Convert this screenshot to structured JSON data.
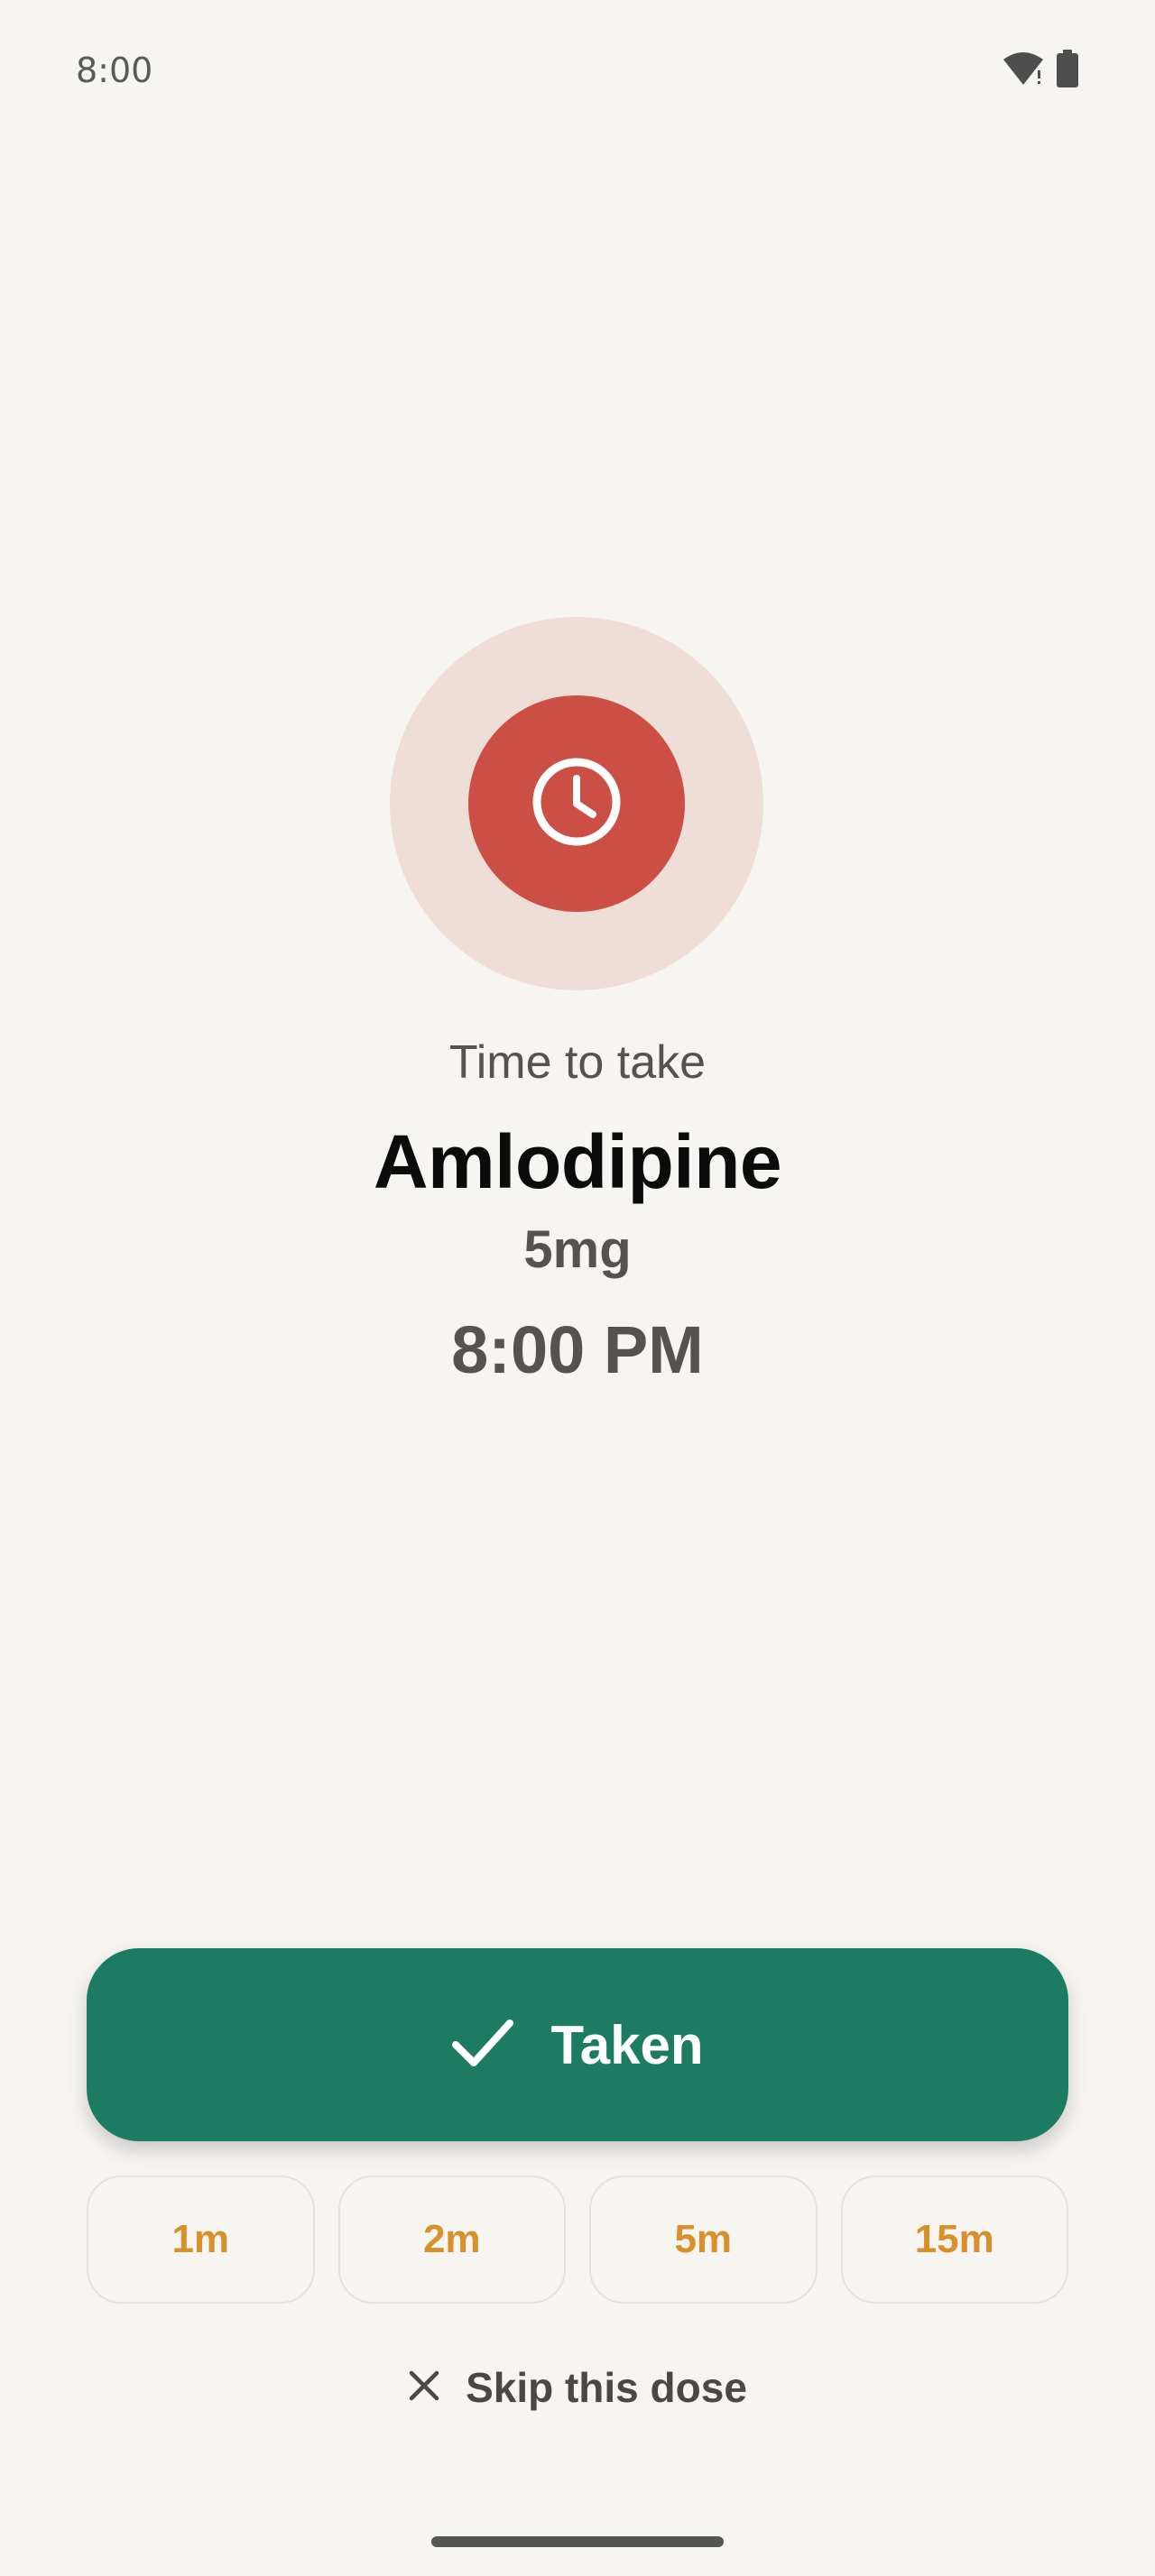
{
  "status_bar": {
    "time": "8:00",
    "icons": [
      "wifi-alert-icon",
      "battery-icon"
    ]
  },
  "reminder": {
    "icon": "clock-icon",
    "subtitle": "Time to take",
    "medication_name": "Amlodipine",
    "dose": "5mg",
    "time": "8:00 PM"
  },
  "actions": {
    "taken_label": "Taken",
    "taken_icon": "check-icon",
    "snooze_options": [
      "1m",
      "2m",
      "5m",
      "15m"
    ],
    "skip_label": "Skip this dose",
    "skip_icon": "close-icon"
  },
  "colors": {
    "background": "#F7F5F2",
    "halo": "#EFDDD7",
    "alarm_red": "#CC4F45",
    "taken_green": "#1C7B61",
    "snooze_orange": "#D9902A",
    "text_primary": "#0B0B0B",
    "text_secondary": "#555350"
  }
}
